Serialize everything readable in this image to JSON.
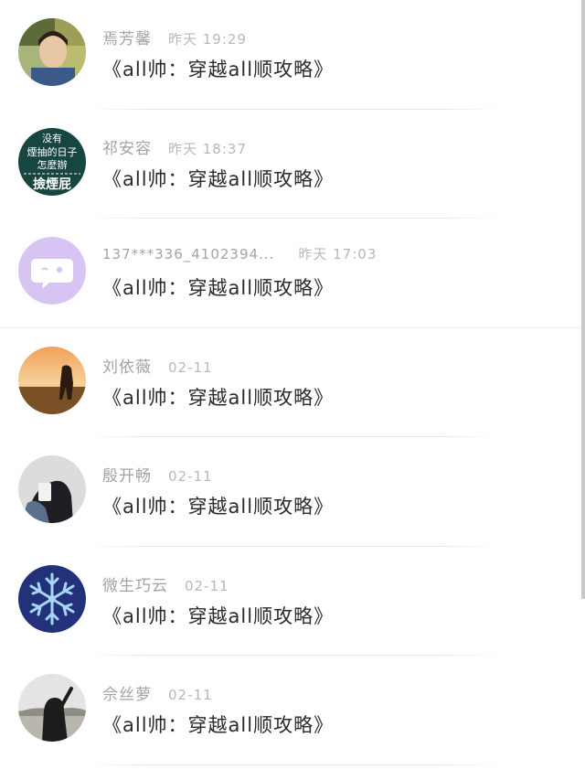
{
  "items": [
    {
      "name": "焉芳馨",
      "time": "昨天 19:29",
      "message": "《all帅：穿越all顺攻略》",
      "avatar": "photo-avatar-icon"
    },
    {
      "name": "祁安容",
      "time": "昨天 18:37",
      "message": "《all帅：穿越all顺攻略》",
      "avatar": "text-avatar-icon",
      "avatar_text": [
        "没有",
        "煙抽的日子",
        "怎麼辦",
        "撿煙屁"
      ]
    },
    {
      "name": "137***336_4102394...",
      "time": "昨天 17:03",
      "message": "《all帅：穿越all顺攻略》",
      "avatar": "chat-bubble-icon"
    },
    {
      "name": "刘依薇",
      "time": "02-11",
      "message": "《all帅：穿越all顺攻略》",
      "avatar": "sunset-photo-icon"
    },
    {
      "name": "殷开畅",
      "time": "02-11",
      "message": "《all帅：穿越all顺攻略》",
      "avatar": "selfie-photo-icon"
    },
    {
      "name": "微生巧云",
      "time": "02-11",
      "message": "《all帅：穿越all顺攻略》",
      "avatar": "snowflake-icon"
    },
    {
      "name": "佘丝萝",
      "time": "02-11",
      "message": "《all帅：穿越all顺攻略》",
      "avatar": "girl-photo-icon"
    }
  ],
  "colors": {
    "name_text": "#a3a3a3",
    "message_text": "#2b2b2b",
    "divider": "#e6e6e6"
  }
}
